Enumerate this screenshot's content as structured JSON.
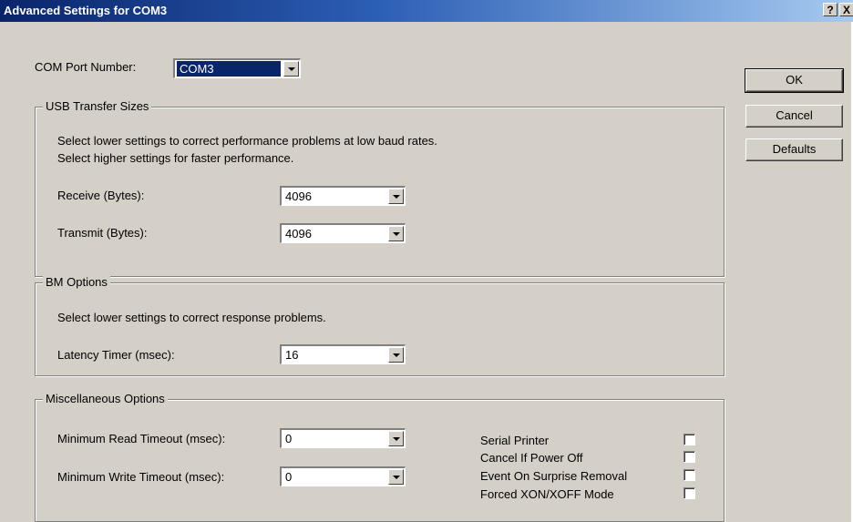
{
  "window": {
    "title": "Advanced Settings for COM3",
    "help_button": "?",
    "close_button": "X"
  },
  "com_port": {
    "label": "COM Port Number:",
    "value": "COM3"
  },
  "buttons": {
    "ok": "OK",
    "cancel": "Cancel",
    "defaults": "Defaults"
  },
  "usb_transfer": {
    "legend": "USB Transfer Sizes",
    "desc_line1": "Select lower settings to correct performance problems at low baud rates.",
    "desc_line2": "Select higher settings for faster performance.",
    "receive_label": "Receive (Bytes):",
    "receive_value": "4096",
    "transmit_label": "Transmit (Bytes):",
    "transmit_value": "4096"
  },
  "bm_options": {
    "legend": "BM Options",
    "desc": "Select lower settings to correct response problems.",
    "latency_label": "Latency Timer (msec):",
    "latency_value": "16"
  },
  "misc_options": {
    "legend": "Miscellaneous Options",
    "min_read_label": "Minimum Read Timeout (msec):",
    "min_read_value": "0",
    "min_write_label": "Minimum Write Timeout (msec):",
    "min_write_value": "0",
    "checkboxes": [
      {
        "label": "Serial Printer",
        "checked": false
      },
      {
        "label": "Cancel If Power Off",
        "checked": false
      },
      {
        "label": "Event On Surprise Removal",
        "checked": false
      },
      {
        "label": "Forced XON/XOFF Mode",
        "checked": false
      }
    ]
  }
}
